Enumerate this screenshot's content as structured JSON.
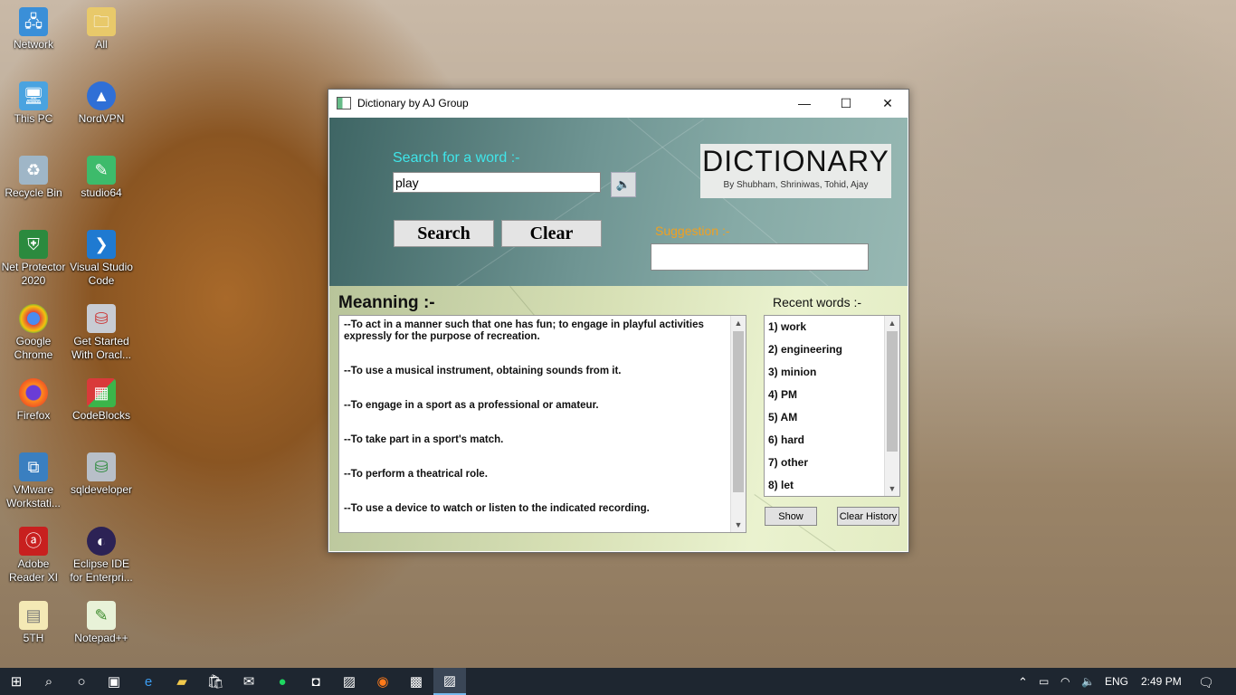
{
  "desktop": {
    "icons": [
      {
        "label": "Network",
        "icon": "network-icon"
      },
      {
        "label": "All",
        "icon": "folder-icon"
      },
      {
        "label": "This PC",
        "icon": "computer-icon"
      },
      {
        "label": "NordVPN",
        "icon": "nordvpn-icon"
      },
      {
        "label": "Recycle Bin",
        "icon": "recycle-bin-icon"
      },
      {
        "label": "studio64",
        "icon": "android-studio-icon"
      },
      {
        "label": "Net Protector 2020",
        "icon": "net-protector-icon"
      },
      {
        "label": "Visual Studio Code",
        "icon": "vscode-icon"
      },
      {
        "label": "Google Chrome",
        "icon": "chrome-icon"
      },
      {
        "label": "Get Started With Oracl...",
        "icon": "oracle-db-icon"
      },
      {
        "label": "Firefox",
        "icon": "firefox-icon"
      },
      {
        "label": "CodeBlocks",
        "icon": "codeblocks-icon"
      },
      {
        "label": "VMware Workstati...",
        "icon": "vmware-icon"
      },
      {
        "label": "sqldeveloper",
        "icon": "sqldeveloper-icon"
      },
      {
        "label": "Adobe Reader XI",
        "icon": "adobe-reader-icon"
      },
      {
        "label": "Eclipse IDE for Enterpri...",
        "icon": "eclipse-icon"
      },
      {
        "label": "5TH",
        "icon": "file-icon"
      },
      {
        "label": "Notepad++",
        "icon": "notepad-plus-icon"
      }
    ]
  },
  "window": {
    "title": "Dictionary by AJ Group",
    "minimize": "—",
    "maximize": "☐",
    "close": "✕"
  },
  "search": {
    "label": "Search for a word :-",
    "value": "play",
    "search_button": "Search",
    "clear_button": "Clear"
  },
  "logo": {
    "title": "DICTIONARY",
    "subtitle": "By Shubham, Shriniwas, Tohid, Ajay"
  },
  "suggestion": {
    "label": "Suggestion :-",
    "value": ""
  },
  "meaning": {
    "title": "Meanning :-",
    "lines": [
      "--To act in a manner such that one has fun; to engage in playful activities expressly for the purpose of recreation.",
      "--To use a musical instrument, obtaining sounds from it.",
      "--To engage in a sport as a professional or amateur.",
      "--To take part in a sport's match.",
      "--To perform a theatrical role.",
      "--To use a device to watch or listen to the indicated recording."
    ]
  },
  "recent": {
    "label": "Recent words :-",
    "items": [
      "1) work",
      "2) engineering",
      "3) minion",
      "4) PM",
      "5) AM",
      "6) hard",
      "7) other",
      "8) let"
    ],
    "show_button": "Show",
    "clear_history_button": "Clear History"
  },
  "taskbar": {
    "language": "ENG",
    "time": "2:49 PM"
  }
}
